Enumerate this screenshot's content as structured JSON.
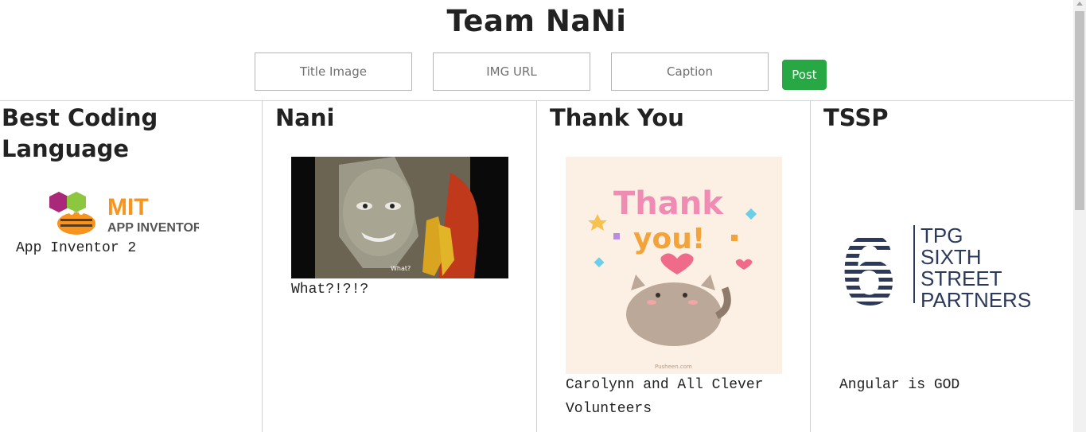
{
  "header": {
    "title": "Team NaNi"
  },
  "form": {
    "title_placeholder": "Title Image",
    "url_placeholder": "IMG URL",
    "caption_placeholder": "Caption",
    "post_label": "Post"
  },
  "cards": [
    {
      "title": "Best Coding Language",
      "caption": "App Inventor 2",
      "image_label": "MIT",
      "image_sublabel": "APP INVENTOR"
    },
    {
      "title": "Nani",
      "caption": "What?!?!?",
      "image_label": "What?"
    },
    {
      "title": "Thank You",
      "caption": "Carolynn and All Clever Volunteers",
      "image_label": "Thank",
      "image_sublabel": "you!",
      "image_footer": "Pusheen.com"
    },
    {
      "title": "TSSP",
      "caption": "Angular is GOD",
      "image_label": "6",
      "logo_lines": [
        "TPG",
        "SIXTH",
        "STREET",
        "PARTNERS"
      ]
    }
  ],
  "colors": {
    "post_button": "#28a745",
    "mit_orange": "#f7941d",
    "mit_purple": "#a9287a",
    "tpg_navy": "#2b3a5c"
  }
}
